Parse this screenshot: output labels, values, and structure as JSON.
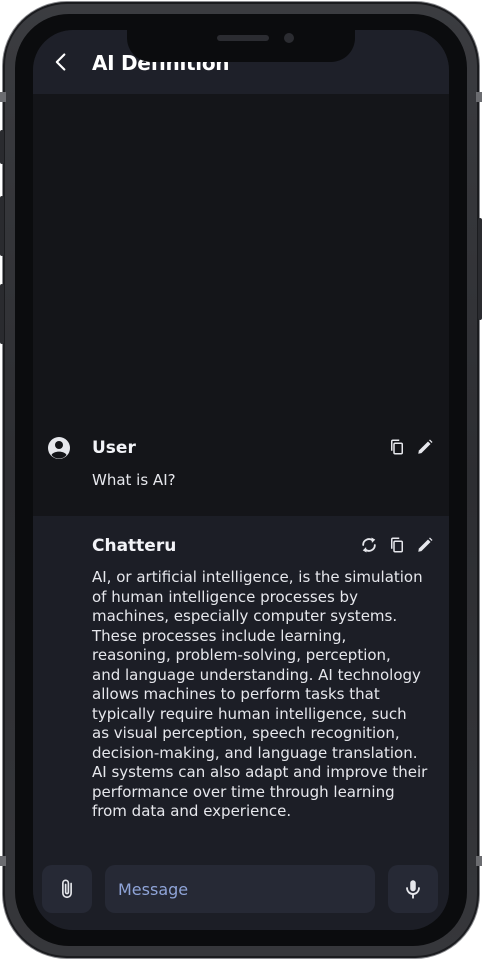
{
  "header": {
    "title": "AI Definition",
    "back_icon": "chevron-left-icon"
  },
  "messages": [
    {
      "sender": "User",
      "avatar_icon": "account-circle-icon",
      "lines": [
        "What is AI?"
      ],
      "actions": [
        "copy-icon",
        "edit-icon"
      ]
    },
    {
      "sender": "Chatteru",
      "lines": [
        "AI, or artificial intelligence, is the simulation",
        "of human intelligence processes by",
        "machines, especially computer systems.",
        "These processes include learning,",
        "reasoning, problem-solving, perception,",
        "and language understanding. AI technology",
        "allows machines to perform tasks that",
        "typically require human intelligence, such",
        "as visual perception, speech recognition,",
        "decision-making, and language translation.",
        "AI systems can also adapt and improve their",
        "performance over time through learning",
        "from data and experience."
      ],
      "actions": [
        "regenerate-icon",
        "copy-icon",
        "edit-icon"
      ]
    }
  ],
  "composer": {
    "placeholder": "Message",
    "value": "",
    "attach_icon": "paperclip-icon",
    "mic_icon": "microphone-icon"
  },
  "colors": {
    "app_bar": "#1e2029",
    "background": "#141519",
    "assistant_bubble": "#1c1e26",
    "input_bg": "#262935",
    "placeholder": "#8fa4d8"
  }
}
